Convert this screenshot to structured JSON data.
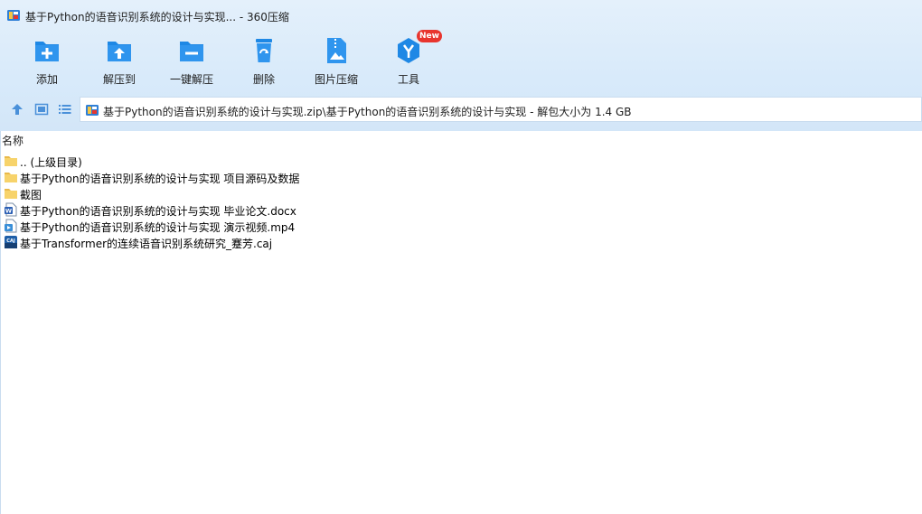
{
  "window": {
    "title": "基于Python的语音识别系统的设计与实现... - 360压缩"
  },
  "toolbar": {
    "add_label": "添加",
    "extract_to_label": "解压到",
    "one_click_extract_label": "一键解压",
    "delete_label": "删除",
    "image_compress_label": "图片压缩",
    "tools_label": "工具",
    "tools_badge": "New"
  },
  "address": {
    "path": "基于Python的语音识别系统的设计与实现.zip\\基于Python的语音识别系统的设计与实现 - 解包大小为 1.4 GB"
  },
  "file_list": {
    "column_name": "名称",
    "rows": [
      {
        "name": ".. (上级目录)",
        "icon": "folder-icon"
      },
      {
        "name": "基于Python的语音识别系统的设计与实现 项目源码及数据",
        "icon": "folder-icon"
      },
      {
        "name": "截图",
        "icon": "folder-icon"
      },
      {
        "name": "基于Python的语音识别系统的设计与实现 毕业论文.docx",
        "icon": "word-doc-icon"
      },
      {
        "name": "基于Python的语音识别系统的设计与实现 演示视频.mp4",
        "icon": "video-file-icon"
      },
      {
        "name": "基于Transformer的连续语音识别系统研究_蹇芳.caj",
        "icon": "caj-file-icon"
      }
    ]
  },
  "colors": {
    "accent": "#1e88e5",
    "toolbar_bg": "#d8eafa",
    "folder": "#f7d36b",
    "badge": "#e8352e"
  }
}
